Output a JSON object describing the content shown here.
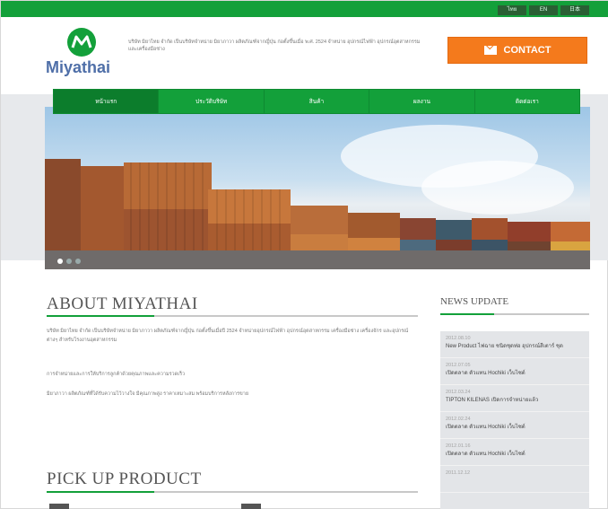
{
  "topbar": {
    "languages": [
      "ไทย",
      "EN",
      "日本"
    ]
  },
  "header": {
    "logo_text": "Miyathai",
    "intro_text": "บริษัท มิยาไทย จำกัด เป็นบริษัทจำหน่าย มิยาภาวา ผลิตภัณฑ์จากญี่ปุ่น ก่อตั้งขึ้นเมื่อ พ.ศ. 2524 จำหน่าย อุปกรณ์ไฟฟ้า อุปกรณ์อุตสาหกรรม และเครื่องมือช่าง",
    "contact_label": "CONTACT"
  },
  "nav": {
    "items": [
      "หน้าแรก",
      "ประวัติบริษัท",
      "สินค้า",
      "ผลงาน",
      "ติดต่อเรา"
    ]
  },
  "about": {
    "heading": "ABOUT MIYATHAI",
    "para1": "บริษัท มิยาไทย จำกัด เป็นบริษัทจำหน่าย มิยาภาวา ผลิตภัณฑ์จากญี่ปุ่น ก่อตั้งขึ้นเมื่อปี 2524 จำหน่ายอุปกรณ์ไฟฟ้า อุปกรณ์อุตสาหกรรม เครื่องมือช่าง เครื่องจักร และอุปกรณ์ต่างๆ สำหรับโรงงานอุตสาหกรรม",
    "para2": "การจำหน่ายและการให้บริการลูกค้าด้วยคุณภาพและความรวดเร็ว",
    "para3": "มิยาภาวา ผลิตภัณฑ์ที่ได้รับความไว้วางใจ มีคุณภาพสูง ราคาเหมาะสม พร้อมบริการหลังการขาย"
  },
  "pickup": {
    "heading": "PICK UP PRODUCT"
  },
  "news": {
    "heading": "NEWS UPDATE",
    "items": [
      {
        "date": "2012.08.10",
        "title": "New Product ไฟฉาย ชนิดชุดท่อ อุปกรณ์สีเตาร์ ชุด"
      },
      {
        "date": "2012.07.05",
        "title": "เปิดตลาด ตัวแทน Hochiki เว็บไซต์"
      },
      {
        "date": "2012.03.24",
        "title": "TIPTON KILENAS เปิดการจำหน่ายแล้ว"
      },
      {
        "date": "2012.02.24",
        "title": "เปิดตลาด ตัวแทน Hochiki เว็บไซต์"
      },
      {
        "date": "2012.01.16",
        "title": "เปิดตลาด ตัวแทน Hochiki เว็บไซต์"
      },
      {
        "date": "2011.12.12",
        "title": ""
      }
    ]
  }
}
